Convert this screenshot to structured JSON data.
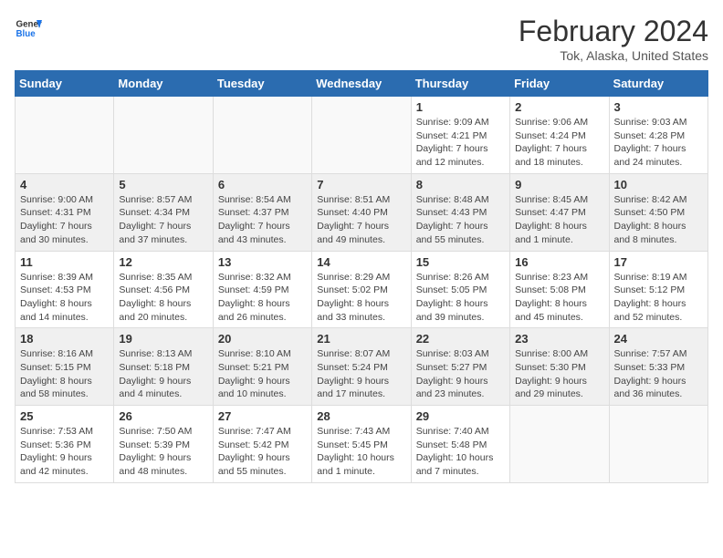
{
  "header": {
    "logo_line1": "General",
    "logo_line2": "Blue",
    "month_title": "February 2024",
    "location": "Tok, Alaska, United States"
  },
  "weekdays": [
    "Sunday",
    "Monday",
    "Tuesday",
    "Wednesday",
    "Thursday",
    "Friday",
    "Saturday"
  ],
  "weeks": [
    [
      {
        "day": "",
        "info": ""
      },
      {
        "day": "",
        "info": ""
      },
      {
        "day": "",
        "info": ""
      },
      {
        "day": "",
        "info": ""
      },
      {
        "day": "1",
        "info": "Sunrise: 9:09 AM\nSunset: 4:21 PM\nDaylight: 7 hours\nand 12 minutes."
      },
      {
        "day": "2",
        "info": "Sunrise: 9:06 AM\nSunset: 4:24 PM\nDaylight: 7 hours\nand 18 minutes."
      },
      {
        "day": "3",
        "info": "Sunrise: 9:03 AM\nSunset: 4:28 PM\nDaylight: 7 hours\nand 24 minutes."
      }
    ],
    [
      {
        "day": "4",
        "info": "Sunrise: 9:00 AM\nSunset: 4:31 PM\nDaylight: 7 hours\nand 30 minutes."
      },
      {
        "day": "5",
        "info": "Sunrise: 8:57 AM\nSunset: 4:34 PM\nDaylight: 7 hours\nand 37 minutes."
      },
      {
        "day": "6",
        "info": "Sunrise: 8:54 AM\nSunset: 4:37 PM\nDaylight: 7 hours\nand 43 minutes."
      },
      {
        "day": "7",
        "info": "Sunrise: 8:51 AM\nSunset: 4:40 PM\nDaylight: 7 hours\nand 49 minutes."
      },
      {
        "day": "8",
        "info": "Sunrise: 8:48 AM\nSunset: 4:43 PM\nDaylight: 7 hours\nand 55 minutes."
      },
      {
        "day": "9",
        "info": "Sunrise: 8:45 AM\nSunset: 4:47 PM\nDaylight: 8 hours\nand 1 minute."
      },
      {
        "day": "10",
        "info": "Sunrise: 8:42 AM\nSunset: 4:50 PM\nDaylight: 8 hours\nand 8 minutes."
      }
    ],
    [
      {
        "day": "11",
        "info": "Sunrise: 8:39 AM\nSunset: 4:53 PM\nDaylight: 8 hours\nand 14 minutes."
      },
      {
        "day": "12",
        "info": "Sunrise: 8:35 AM\nSunset: 4:56 PM\nDaylight: 8 hours\nand 20 minutes."
      },
      {
        "day": "13",
        "info": "Sunrise: 8:32 AM\nSunset: 4:59 PM\nDaylight: 8 hours\nand 26 minutes."
      },
      {
        "day": "14",
        "info": "Sunrise: 8:29 AM\nSunset: 5:02 PM\nDaylight: 8 hours\nand 33 minutes."
      },
      {
        "day": "15",
        "info": "Sunrise: 8:26 AM\nSunset: 5:05 PM\nDaylight: 8 hours\nand 39 minutes."
      },
      {
        "day": "16",
        "info": "Sunrise: 8:23 AM\nSunset: 5:08 PM\nDaylight: 8 hours\nand 45 minutes."
      },
      {
        "day": "17",
        "info": "Sunrise: 8:19 AM\nSunset: 5:12 PM\nDaylight: 8 hours\nand 52 minutes."
      }
    ],
    [
      {
        "day": "18",
        "info": "Sunrise: 8:16 AM\nSunset: 5:15 PM\nDaylight: 8 hours\nand 58 minutes."
      },
      {
        "day": "19",
        "info": "Sunrise: 8:13 AM\nSunset: 5:18 PM\nDaylight: 9 hours\nand 4 minutes."
      },
      {
        "day": "20",
        "info": "Sunrise: 8:10 AM\nSunset: 5:21 PM\nDaylight: 9 hours\nand 10 minutes."
      },
      {
        "day": "21",
        "info": "Sunrise: 8:07 AM\nSunset: 5:24 PM\nDaylight: 9 hours\nand 17 minutes."
      },
      {
        "day": "22",
        "info": "Sunrise: 8:03 AM\nSunset: 5:27 PM\nDaylight: 9 hours\nand 23 minutes."
      },
      {
        "day": "23",
        "info": "Sunrise: 8:00 AM\nSunset: 5:30 PM\nDaylight: 9 hours\nand 29 minutes."
      },
      {
        "day": "24",
        "info": "Sunrise: 7:57 AM\nSunset: 5:33 PM\nDaylight: 9 hours\nand 36 minutes."
      }
    ],
    [
      {
        "day": "25",
        "info": "Sunrise: 7:53 AM\nSunset: 5:36 PM\nDaylight: 9 hours\nand 42 minutes."
      },
      {
        "day": "26",
        "info": "Sunrise: 7:50 AM\nSunset: 5:39 PM\nDaylight: 9 hours\nand 48 minutes."
      },
      {
        "day": "27",
        "info": "Sunrise: 7:47 AM\nSunset: 5:42 PM\nDaylight: 9 hours\nand 55 minutes."
      },
      {
        "day": "28",
        "info": "Sunrise: 7:43 AM\nSunset: 5:45 PM\nDaylight: 10 hours\nand 1 minute."
      },
      {
        "day": "29",
        "info": "Sunrise: 7:40 AM\nSunset: 5:48 PM\nDaylight: 10 hours\nand 7 minutes."
      },
      {
        "day": "",
        "info": ""
      },
      {
        "day": "",
        "info": ""
      }
    ]
  ]
}
